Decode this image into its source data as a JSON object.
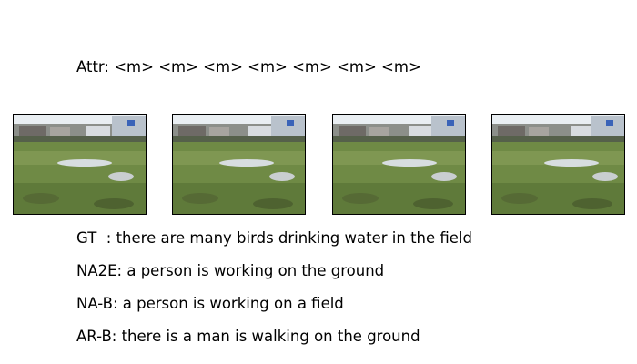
{
  "attr_line": "Attr: <m> <m> <m> <m> <m> <m> <m>",
  "frames": [
    {
      "name": "frame-1"
    },
    {
      "name": "frame-2"
    },
    {
      "name": "frame-3"
    },
    {
      "name": "frame-4"
    }
  ],
  "captions": {
    "gt": "GT  : there are many birds drinking water in the field",
    "na2e": "NA2E: a person is working on the ground",
    "na_b": "NA-B: a person is working on a field",
    "ar_b": "AR-B: there is a man is walking on the ground"
  }
}
